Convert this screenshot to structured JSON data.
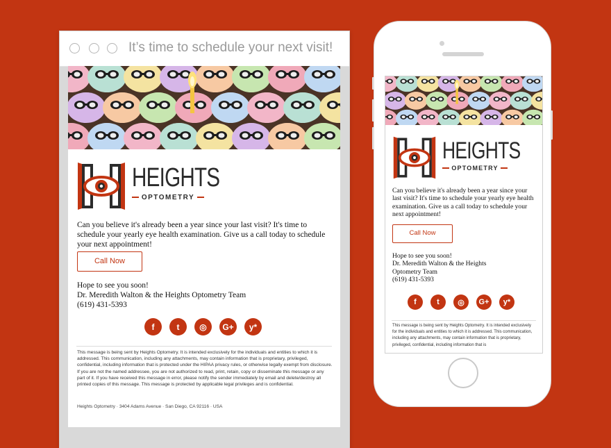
{
  "window": {
    "title": "It’s time to schedule your next visit!"
  },
  "brand": {
    "name": "HEIGHTS",
    "sub": "OPTOMETRY",
    "accent": "#c23512",
    "background": "#c23512"
  },
  "email": {
    "body": "Can you believe it's already been a year since your last visit? It's time to schedule your yearly eye health examination. Give us a call today to schedule your next appointment!",
    "cta_label": "Call Now",
    "signoff": "Hope to see you soon!",
    "signature": "Dr. Meredith Walton & the Heights Optometry Team",
    "phone": "(619) 431-5393",
    "legal": "This message is being sent by Heights Optometry. It is intended exclusively for the individuals and entities to which it is addressed. This communication, including any attachments, may contain information that is proprietary, privileged, confidential, including information that is protected under the HIPAA privacy rules, or otherwise legally exempt from disclosure. If you are not the named addressee, you are not authorized to read, print, retain, copy or disseminate this message or any part of it. If you have received this message in error, please notify the sender immediately by email and delete/destroy all printed copies of this message. This message is protected by applicable legal privileges and is confidential.",
    "address": "Heights Optometry · 3404 Adams Avenue · San Diego, CA 92116 · USA"
  },
  "mobile": {
    "body": "Can you believe it's already been a year since your last visit? It's time to schedule your yearly eye health examination. Give us a call today to schedule your next appointment!",
    "cta_label": "Call Now",
    "signoff": "Hope to see you soon!",
    "signature_line1": "Dr. Meredith Walton & the Heights",
    "signature_line2": "Optometry Team",
    "phone": "(619) 431-5393",
    "legal": "This message is being sent by Heights Optometry. It is intended exclusively for the individuals and entities to which it is addressed. This communication, including any attachments, may contain information that is proprietary, privileged, confidential, including information that is"
  },
  "social": [
    {
      "name": "facebook-icon",
      "glyph": "f"
    },
    {
      "name": "twitter-icon",
      "glyph": "t"
    },
    {
      "name": "instagram-icon",
      "glyph": "◎"
    },
    {
      "name": "google-plus-icon",
      "glyph": "G+"
    },
    {
      "name": "yelp-icon",
      "glyph": "y*"
    }
  ]
}
